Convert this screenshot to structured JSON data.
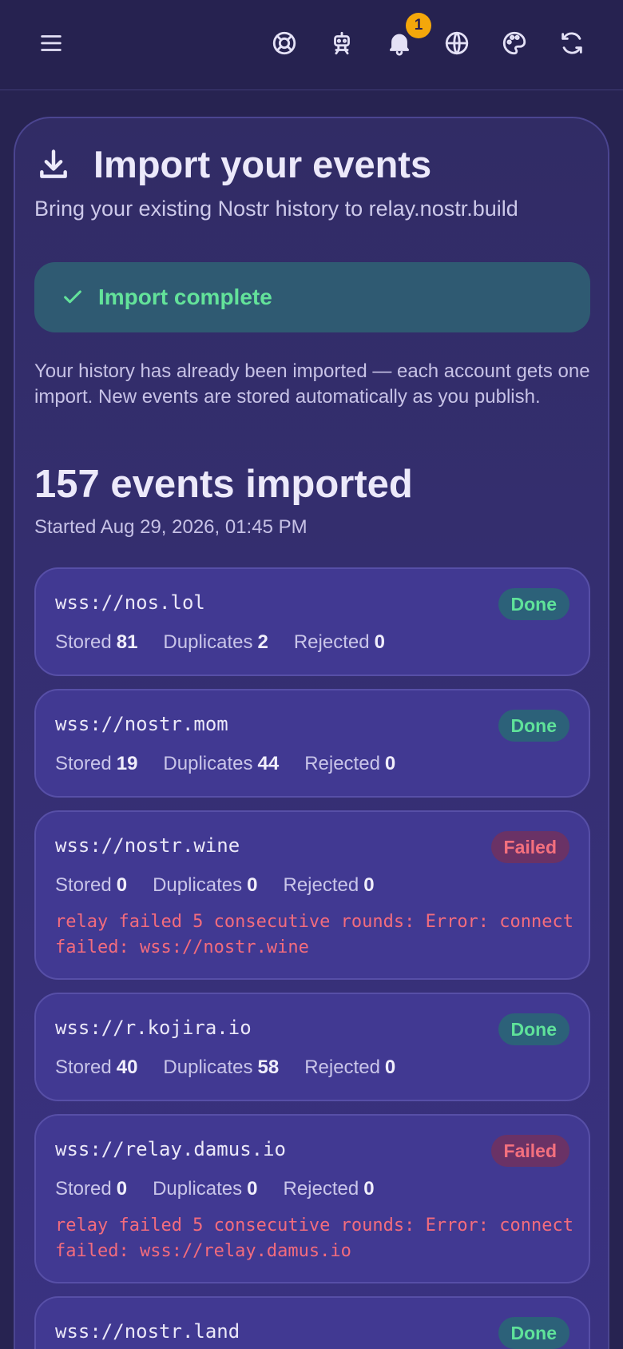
{
  "header": {
    "menu_icon": "hamburger-icon",
    "icons": [
      "lifebuoy-icon",
      "robot-icon",
      "bell-icon",
      "globe-icon",
      "palette-icon",
      "refresh-icon"
    ],
    "notification_count": "1"
  },
  "page": {
    "title": "Import your events",
    "subtitle": "Bring your existing Nostr history to relay.nostr.build",
    "status_banner": "Import complete",
    "note": "Your history has already been imported — each account gets one import. New events are stored automatically as you publish.",
    "events_imported": "157 events imported",
    "started": "Started Aug 29, 2026, 01:45 PM"
  },
  "labels": {
    "stored": "Stored",
    "duplicates": "Duplicates",
    "rejected": "Rejected"
  },
  "relays": [
    {
      "url": "wss://nos.lol",
      "status": "Done",
      "stored": "81",
      "duplicates": "2",
      "rejected": "0",
      "error": ""
    },
    {
      "url": "wss://nostr.mom",
      "status": "Done",
      "stored": "19",
      "duplicates": "44",
      "rejected": "0",
      "error": ""
    },
    {
      "url": "wss://nostr.wine",
      "status": "Failed",
      "stored": "0",
      "duplicates": "0",
      "rejected": "0",
      "error": "relay failed 5 consecutive rounds: Error: connect failed: wss://nostr.wine"
    },
    {
      "url": "wss://r.kojira.io",
      "status": "Done",
      "stored": "40",
      "duplicates": "58",
      "rejected": "0",
      "error": ""
    },
    {
      "url": "wss://relay.damus.io",
      "status": "Failed",
      "stored": "0",
      "duplicates": "0",
      "rejected": "0",
      "error": "relay failed 5 consecutive rounds: Error: connect failed: wss://relay.damus.io"
    },
    {
      "url": "wss://nostr.land",
      "status": "Done"
    }
  ],
  "colors": {
    "background": "#272351",
    "done": "#5fe29a",
    "failed": "#f36c7d",
    "badge": "#f4a70b"
  }
}
